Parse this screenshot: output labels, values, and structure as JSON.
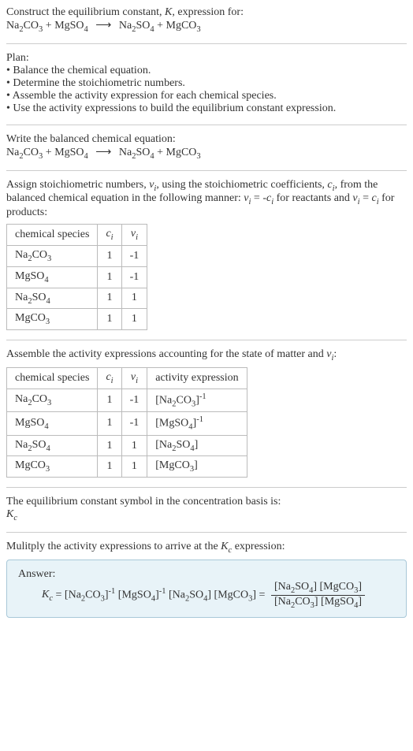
{
  "intro": {
    "line1": "Construct the equilibrium constant, ",
    "line1_after": ", expression for:"
  },
  "equation": {
    "r1": "Na",
    "r1s": "2",
    "r1b": "CO",
    "r1bs": "3",
    "plus": " + ",
    "r2": "MgSO",
    "r2s": "4",
    "arrow": "⟶",
    "p1": "Na",
    "p1s": "2",
    "p1b": "SO",
    "p1bs": "4",
    "p2": "MgCO",
    "p2s": "3"
  },
  "plan": {
    "title": "Plan:",
    "b1": "• Balance the chemical equation.",
    "b2": "• Determine the stoichiometric numbers.",
    "b3": "• Assemble the activity expression for each chemical species.",
    "b4": "• Use the activity expressions to build the equilibrium constant expression."
  },
  "balanced": {
    "title": "Write the balanced chemical equation:"
  },
  "stoich": {
    "text1": "Assign stoichiometric numbers, ",
    "text2": ", using the stoichiometric coefficients, ",
    "text3": ", from the balanced chemical equation in the following manner: ",
    "text4": " for reactants and ",
    "text5": " for products:"
  },
  "table1": {
    "h1": "chemical species",
    "h2": "c",
    "h3": "ν",
    "rows": [
      {
        "sp": "Na₂CO₃",
        "c": "1",
        "v": "-1"
      },
      {
        "sp": "MgSO₄",
        "c": "1",
        "v": "-1"
      },
      {
        "sp": "Na₂SO₄",
        "c": "1",
        "v": "1"
      },
      {
        "sp": "MgCO₃",
        "c": "1",
        "v": "1"
      }
    ]
  },
  "activity": {
    "text": "Assemble the activity expressions accounting for the state of matter and "
  },
  "table2": {
    "h1": "chemical species",
    "h2": "c",
    "h3": "ν",
    "h4": "activity expression",
    "rows": [
      {
        "sp": "Na₂CO₃",
        "c": "1",
        "v": "-1",
        "ae_pre": "[Na",
        "ae_s1": "2",
        "ae_mid": "CO",
        "ae_s2": "3",
        "ae_pow": "-1"
      },
      {
        "sp": "MgSO₄",
        "c": "1",
        "v": "-1",
        "ae_pre": "[MgSO",
        "ae_s1": "",
        "ae_mid": "",
        "ae_s2": "4",
        "ae_pow": "-1"
      },
      {
        "sp": "Na₂SO₄",
        "c": "1",
        "v": "1",
        "ae_pre": "[Na",
        "ae_s1": "2",
        "ae_mid": "SO",
        "ae_s2": "4",
        "ae_pow": ""
      },
      {
        "sp": "MgCO₃",
        "c": "1",
        "v": "1",
        "ae_pre": "[MgCO",
        "ae_s1": "",
        "ae_mid": "",
        "ae_s2": "3",
        "ae_pow": ""
      }
    ]
  },
  "kc_symbol": {
    "text": "The equilibrium constant symbol in the concentration basis is:",
    "sym": "K",
    "sub": "c"
  },
  "multiply": {
    "text": "Mulitply the activity expressions to arrive at the ",
    "text2": " expression:"
  },
  "answer": {
    "label": "Answer:",
    "eq_prefix": " = "
  }
}
